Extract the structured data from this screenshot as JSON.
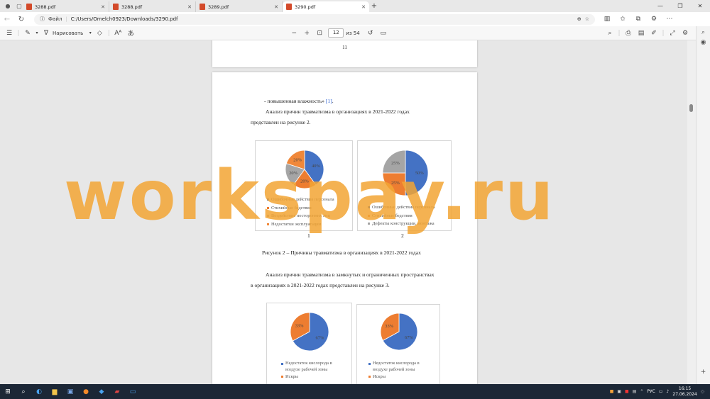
{
  "tabs": [
    {
      "title": "3288.pdf",
      "active": false
    },
    {
      "title": "3288.pdf",
      "active": false
    },
    {
      "title": "3289.pdf",
      "active": false
    },
    {
      "title": "3290.pdf",
      "active": true
    }
  ],
  "address": {
    "label": "Файл",
    "url": "C:/Users/Omelch0923/Downloads/3290.pdf"
  },
  "pdf_toolbar": {
    "draw_label": "Нарисовать",
    "page_current": "12",
    "page_total": "из 54"
  },
  "page1": {
    "number": "11"
  },
  "page2": {
    "line1_prefix": "-  повышенная влажность» ",
    "line1_link": "[1]",
    "line1_suffix": ".",
    "para1_line1": "Анализ   причин   травматизма   в   организациях   в   2021-2022   годах",
    "para1_line2": "представлен на рисунке 2.",
    "figure2_caption": "Рисунок 2 – Причины травматизма в организациях в 2021-2022 годах",
    "para2_line1": "Анализ причин травматизма в замкнутых и ограниченных пространствах",
    "para2_line2": "в организациях в 2021-2022 годах представлен на рисунке 3."
  },
  "chart_data": [
    {
      "type": "pie",
      "sublabel": "1",
      "categories": [
        "Ошибочные действия персонала",
        "Стихийные бедствия",
        "Воздействие посторонних лиц",
        "Недостатки эксплуатации"
      ],
      "values": [
        40,
        20,
        20,
        20
      ],
      "labels": [
        "40%",
        "20%",
        "20%",
        "20%"
      ],
      "colors": [
        "#4472c4",
        "#ed7d31",
        "#a5a5a5",
        "#f0883a"
      ]
    },
    {
      "type": "pie",
      "sublabel": "2",
      "categories": [
        "Ошибочные действия персонала",
        "Стихийные бедствия",
        "Дефекты конструкции, монтажа"
      ],
      "values": [
        50,
        25,
        25
      ],
      "labels": [
        "50%",
        "25%",
        "25%"
      ],
      "colors": [
        "#4472c4",
        "#ed7d31",
        "#a5a5a5"
      ]
    },
    {
      "type": "pie",
      "categories": [
        "Недостаток кислорода в воздухе рабочей зоны",
        "Искры"
      ],
      "values": [
        67,
        33
      ],
      "labels": [
        "67%",
        "33%"
      ],
      "colors": [
        "#4472c4",
        "#ed7d31"
      ]
    },
    {
      "type": "pie",
      "categories": [
        "Недостаток кислорода в воздухе рабочей зоны",
        "Искры"
      ],
      "values": [
        67,
        33
      ],
      "labels": [
        "67%",
        "33%"
      ],
      "colors": [
        "#4472c4",
        "#ed7d31"
      ]
    }
  ],
  "watermark": "workspay.ru",
  "taskbar": {
    "lang": "РУС",
    "time": "16:15",
    "date": "27.06.2024"
  }
}
